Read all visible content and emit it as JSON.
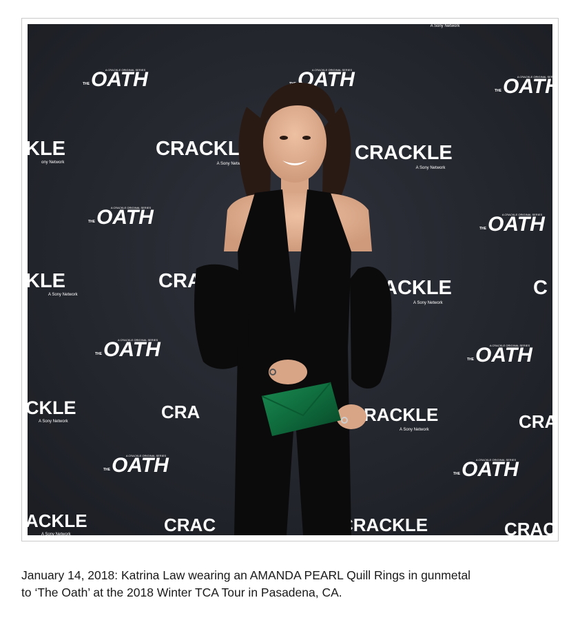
{
  "photo": {
    "backdrop_logos": {
      "oath_text": "OATH",
      "oath_prefix": "THE",
      "oath_overline": "A CRACKLE ORIGINAL SERIES",
      "crackle_text": "CRACKLE",
      "crackle_tagline": "A Sony Network",
      "top_fragment": "A Sony Network"
    },
    "colors": {
      "backdrop": "#23252d",
      "logo": "#ffffff",
      "clutch": "#0f6b3c",
      "outfit": "#0b0b0c",
      "skin": "#e2b293",
      "hair": "#2a1a14"
    }
  },
  "caption": {
    "line1": "January 14, 2018: Katrina Law wearing an AMANDA PEARL Quill Rings in gunmetal",
    "line2": "to ‘The Oath’ at the 2018 Winter TCA Tour in Pasadena, CA."
  }
}
